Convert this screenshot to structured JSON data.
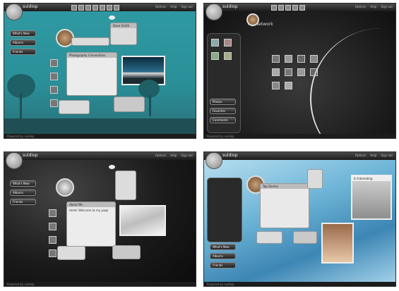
{
  "screens": [
    {
      "brand": "suldiop",
      "menu": [
        "What's New",
        "Albums",
        "Friends"
      ],
      "note_title": "Photography Connections",
      "note_text": "",
      "profile_name": "Dave Smith",
      "status": "Powered by suldiop",
      "toolbar_links": [
        "Options",
        "Help",
        "Sign out"
      ]
    },
    {
      "brand": "suldiop",
      "section_title": "My Network",
      "menu": [
        "Photos",
        "Favorites",
        "Comments"
      ],
      "status": "Powered by suldiop",
      "toolbar_links": [
        "Options",
        "Help",
        "Sign out"
      ]
    },
    {
      "brand": "suldiop",
      "menu": [
        "What's New",
        "Albums",
        "Friends"
      ],
      "note_title": "About Me",
      "note_text": "Hello! Welcome to my page",
      "status": "Powered by suldiop",
      "toolbar_links": [
        "Options",
        "Help",
        "Sign out"
      ]
    },
    {
      "brand": "suldiop",
      "menu": [
        "What's New",
        "Albums",
        "Friends"
      ],
      "note_title": "Top Stories",
      "photo_caption": "In Interesting",
      "status": "Powered by suldiop",
      "toolbar_links": [
        "Options",
        "Help",
        "Sign out"
      ]
    }
  ]
}
